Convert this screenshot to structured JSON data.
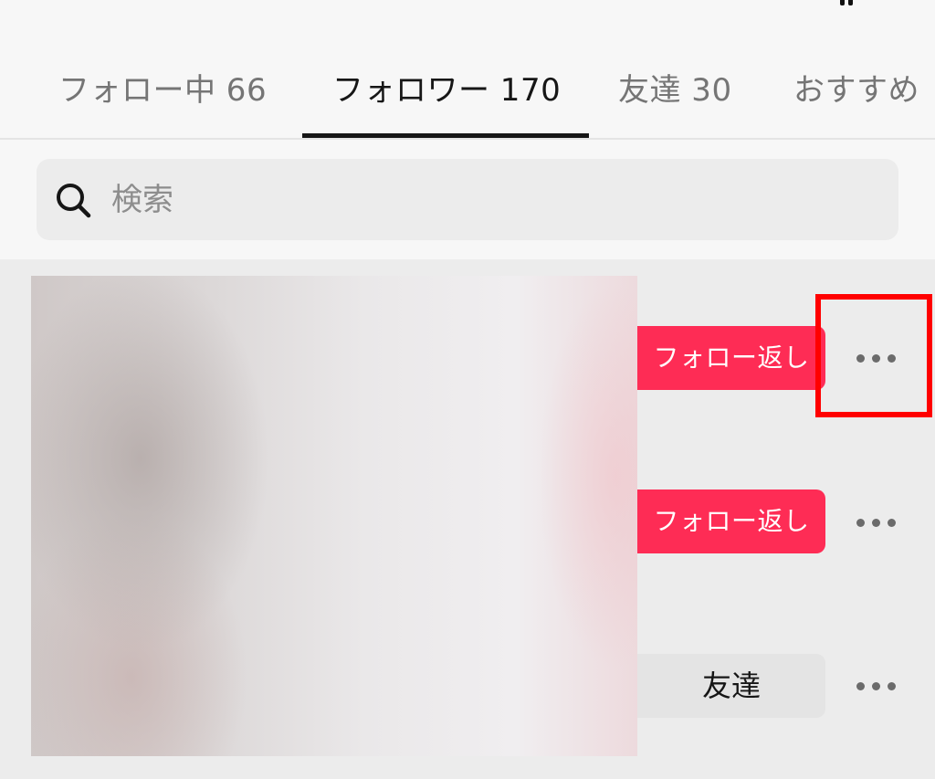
{
  "tabs": [
    {
      "label": "フォロー中 66",
      "active": false
    },
    {
      "label": "フォロワー 170",
      "active": true
    },
    {
      "label": "友達 30",
      "active": false
    },
    {
      "label": "おすすめ",
      "active": false
    }
  ],
  "search": {
    "placeholder": "検索",
    "value": "",
    "icon": "search-icon"
  },
  "rows": [
    {
      "action_label": "フォロー返し",
      "action_type": "follow-back",
      "more_icon": "more-icon",
      "highlighted": true
    },
    {
      "action_label": "フォロー返し",
      "action_type": "follow-back",
      "more_icon": "more-icon",
      "highlighted": false
    },
    {
      "action_label": "友達",
      "action_type": "friend",
      "more_icon": "more-icon",
      "highlighted": false
    }
  ],
  "colors": {
    "accent": "#fe2c55",
    "highlight": "#ff0000",
    "active_tab": "#161616",
    "inactive_tab": "#757575"
  }
}
